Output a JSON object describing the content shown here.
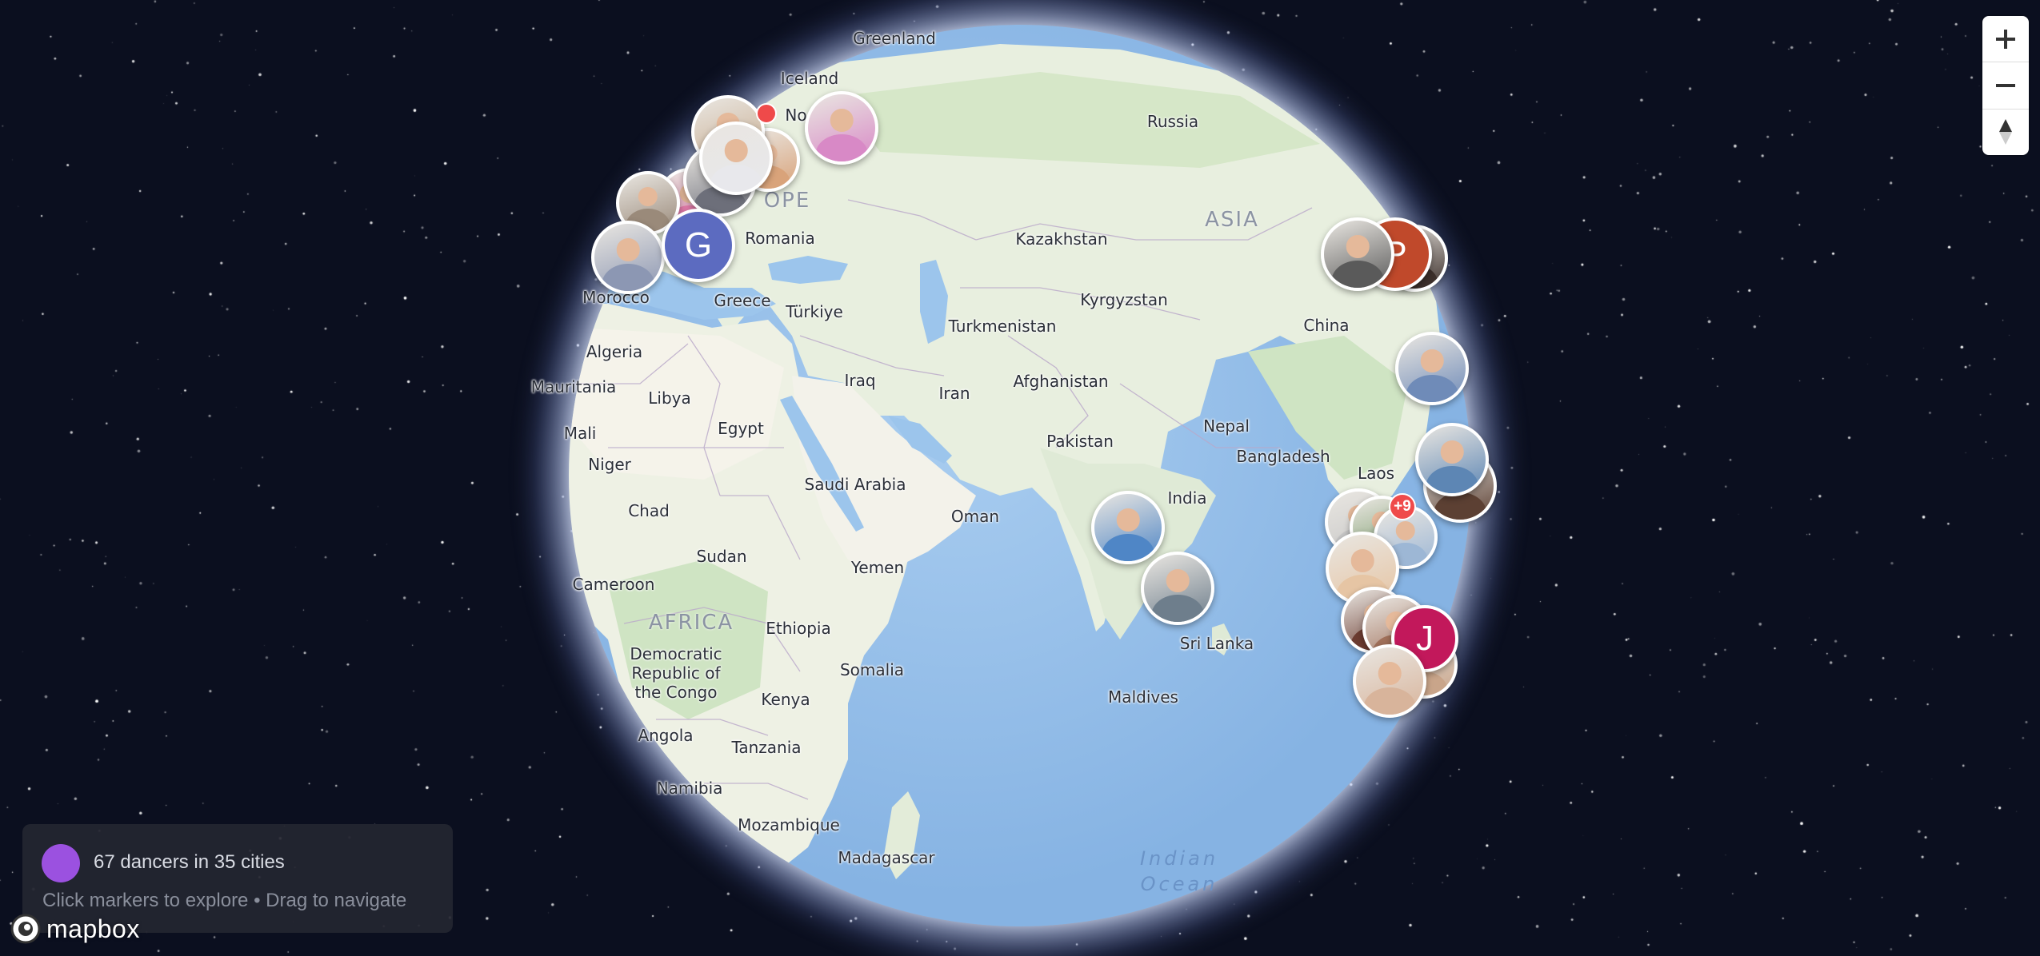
{
  "map": {
    "labels": [
      {
        "id": "greenland",
        "text": "Greenland"
      },
      {
        "id": "iceland",
        "text": "Iceland"
      },
      {
        "id": "russia",
        "text": "Russia"
      },
      {
        "id": "europe",
        "text": "OPE"
      },
      {
        "id": "asia",
        "text": "ASIA"
      },
      {
        "id": "romania",
        "text": "Romania"
      },
      {
        "id": "kazakhstan",
        "text": "Kazakhstan"
      },
      {
        "id": "morocco",
        "text": "Morocco"
      },
      {
        "id": "greece",
        "text": "Greece"
      },
      {
        "id": "turkiye",
        "text": "Türkiye"
      },
      {
        "id": "turkmenistan",
        "text": "Turkmenistan"
      },
      {
        "id": "kyrgyzstan",
        "text": "Kyrgyzstan"
      },
      {
        "id": "china",
        "text": "China"
      },
      {
        "id": "algeria",
        "text": "Algeria"
      },
      {
        "id": "mauritania",
        "text": "Mauritania"
      },
      {
        "id": "libya",
        "text": "Libya"
      },
      {
        "id": "iraq",
        "text": "Iraq"
      },
      {
        "id": "iran",
        "text": "Iran"
      },
      {
        "id": "afghanistan",
        "text": "Afghanistan"
      },
      {
        "id": "mali",
        "text": "Mali"
      },
      {
        "id": "egypt",
        "text": "Egypt"
      },
      {
        "id": "nepal",
        "text": "Nepal"
      },
      {
        "id": "pakistan",
        "text": "Pakistan"
      },
      {
        "id": "bangladesh",
        "text": "Bangladesh"
      },
      {
        "id": "niger",
        "text": "Niger"
      },
      {
        "id": "laos",
        "text": "Laos"
      },
      {
        "id": "saudi",
        "text": "Saudi Arabia"
      },
      {
        "id": "india",
        "text": "India"
      },
      {
        "id": "chad",
        "text": "Chad"
      },
      {
        "id": "oman",
        "text": "Oman"
      },
      {
        "id": "sudan",
        "text": "Sudan"
      },
      {
        "id": "yemen",
        "text": "Yemen"
      },
      {
        "id": "cameroon",
        "text": "Cameroon"
      },
      {
        "id": "africa",
        "text": "AFRICA"
      },
      {
        "id": "ethiopia",
        "text": "Ethiopia"
      },
      {
        "id": "srilanka",
        "text": "Sri Lanka"
      },
      {
        "id": "drc",
        "text": "Democratic\nRepublic of\nthe Congo"
      },
      {
        "id": "somalia",
        "text": "Somalia"
      },
      {
        "id": "kenya",
        "text": "Kenya"
      },
      {
        "id": "maldives",
        "text": "Maldives"
      },
      {
        "id": "angola",
        "text": "Angola"
      },
      {
        "id": "tanzania",
        "text": "Tanzania"
      },
      {
        "id": "namibia",
        "text": "Namibia"
      },
      {
        "id": "mozambique",
        "text": "Mozambique"
      },
      {
        "id": "madagascar",
        "text": "Madagascar"
      },
      {
        "id": "indianocean",
        "text": "Indian\nOcean"
      },
      {
        "id": "no",
        "text": "No"
      }
    ],
    "markers": [
      {
        "id": "eu-1",
        "letter": "",
        "bg": "#d9a37a"
      },
      {
        "id": "eu-2",
        "letter": "",
        "bg": "#c7aa8c"
      },
      {
        "id": "eu-3",
        "letter": "",
        "bg": "#e07aa8"
      },
      {
        "id": "eu-4",
        "letter": "",
        "bg": "#6d6f7a"
      },
      {
        "id": "eu-5",
        "letter": "",
        "bg": "#e8e8ec"
      },
      {
        "id": "eu-6",
        "letter": "",
        "bg": "#d889c6"
      },
      {
        "id": "eu-7",
        "letter": "",
        "bg": "#9a8a7a"
      },
      {
        "id": "eu-8",
        "letter": "G",
        "bg": "#5c6bc0"
      },
      {
        "id": "eu-9",
        "letter": "",
        "bg": "#8c97b3"
      },
      {
        "id": "cn-1",
        "letter": "",
        "bg": "#5a5a5a"
      },
      {
        "id": "cn-2",
        "letter": "P",
        "bg": "#c0492b"
      },
      {
        "id": "cn-3",
        "letter": "",
        "bg": "#3c2f2a"
      },
      {
        "id": "cn-4",
        "letter": "",
        "bg": "#6f8bb8"
      },
      {
        "id": "sea-1",
        "letter": "",
        "bg": "#5c4033"
      },
      {
        "id": "sea-2",
        "letter": "",
        "bg": "#5d86b4"
      },
      {
        "id": "sea-3",
        "letter": "",
        "bg": "#c7c7c7"
      },
      {
        "id": "sea-4",
        "letter": "",
        "bg": "#7a9c6b"
      },
      {
        "id": "sea-5",
        "letter": "",
        "bg": "#9db7d5"
      },
      {
        "id": "sea-6",
        "letter": "",
        "bg": "#e6c5a4"
      },
      {
        "id": "in-1",
        "letter": "",
        "bg": "#4f86c6"
      },
      {
        "id": "in-2",
        "letter": "",
        "bg": "#6e7e8c"
      },
      {
        "id": "sg-1",
        "letter": "",
        "bg": "#6b3b30"
      },
      {
        "id": "sg-2",
        "letter": "",
        "bg": "#a0705a"
      },
      {
        "id": "sg-3",
        "letter": "",
        "bg": "#c9a58a"
      },
      {
        "id": "sg-4",
        "letter": "J",
        "bg": "#c2185b"
      },
      {
        "id": "sg-5",
        "letter": "",
        "bg": "#d8b49b"
      }
    ],
    "badges": [
      {
        "id": "eu-badge",
        "text": ""
      },
      {
        "id": "sea-badge",
        "text": "+9"
      }
    ]
  },
  "controls": {
    "zoom_in_icon": "plus-icon",
    "zoom_out_icon": "minus-icon",
    "compass_icon": "compass-icon"
  },
  "info": {
    "count_text": "67 dancers in 35 cities",
    "hint_text": "Click markers to explore • Drag to navigate",
    "dot_color": "#9b51e0"
  },
  "attribution": {
    "logo_text": "mapbox"
  },
  "colors": {
    "space": "#0b0f1f",
    "ocean": "#9dc3e8",
    "land": "#e9efe0",
    "badge": "#ef4a4a"
  }
}
